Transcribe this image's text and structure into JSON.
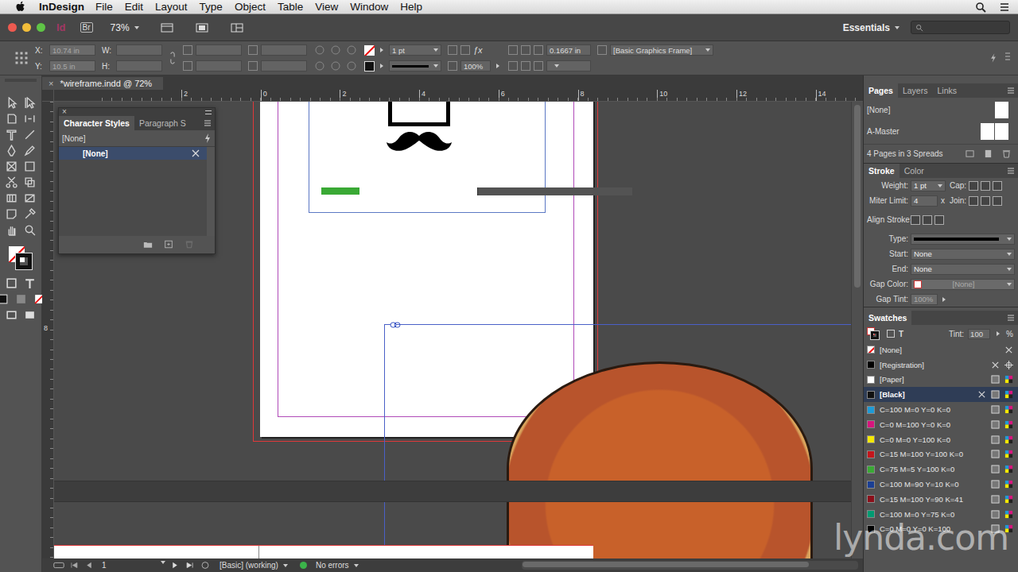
{
  "menubar": {
    "app": "InDesign",
    "items": [
      "File",
      "Edit",
      "Layout",
      "Type",
      "Object",
      "Table",
      "View",
      "Window",
      "Help"
    ]
  },
  "appbar": {
    "logo": "Id",
    "bridge": "Br",
    "zoom": "73%",
    "workspace": "Essentials"
  },
  "control": {
    "x": {
      "label": "X:",
      "value": "10.74 in"
    },
    "y": {
      "label": "Y:",
      "value": "10.5 in"
    },
    "w": {
      "label": "W:"
    },
    "h": {
      "label": "H:"
    },
    "stroke_weight": "1 pt",
    "opacity": "100%",
    "corner": "0.1667 in",
    "object_style": "[Basic Graphics Frame]"
  },
  "document": {
    "tab": "*wireframe.indd @ 72%",
    "close": "×",
    "h_ruler": [
      "2",
      "0",
      "2",
      "4",
      "6",
      "8",
      "10",
      "12",
      "14"
    ],
    "v_ruler": [
      "8"
    ]
  },
  "character_styles": {
    "close": "×",
    "tabs": [
      {
        "label": "Character Styles",
        "selected": true
      },
      {
        "label": "Paragraph S",
        "selected": false
      }
    ],
    "current": "[None]",
    "items": [
      {
        "label": "[None]",
        "selected": true
      }
    ]
  },
  "pages_panel": {
    "tabs": [
      {
        "label": "Pages",
        "selected": true
      },
      {
        "label": "Layers",
        "selected": false
      },
      {
        "label": "Links",
        "selected": false
      }
    ],
    "items": [
      {
        "label": "[None]",
        "pages": 1
      },
      {
        "label": "A-Master",
        "pages": 2
      }
    ],
    "summary": "4 Pages in 3 Spreads"
  },
  "stroke_panel": {
    "tabs": [
      {
        "label": "Stroke",
        "selected": true
      },
      {
        "label": "Color",
        "selected": false
      }
    ],
    "weight": {
      "label": "Weight:",
      "value": "1 pt"
    },
    "cap_label": "Cap:",
    "miter": {
      "label": "Miter Limit:",
      "value": "4",
      "times": "x"
    },
    "join_label": "Join:",
    "align_label": "Align Stroke:",
    "type_label": "Type:",
    "start": {
      "label": "Start:",
      "value": "None"
    },
    "end": {
      "label": "End:",
      "value": "None"
    },
    "gap_color": {
      "label": "Gap Color:",
      "value": "[None]"
    },
    "gap_tint": {
      "label": "Gap Tint:",
      "value": "100%"
    }
  },
  "swatches": {
    "title": "Swatches",
    "text_icon": "T",
    "tint_label": "Tint:",
    "tint": "100",
    "percent": "%",
    "items": [
      {
        "name": "[None]",
        "kind": "none",
        "color": "#ffffff",
        "locked": true,
        "selected": false
      },
      {
        "name": "[Registration]",
        "kind": "registration",
        "color": "#000000",
        "locked": true,
        "selected": false
      },
      {
        "name": "[Paper]",
        "kind": "process",
        "color": "#ffffff",
        "locked": false,
        "selected": false
      },
      {
        "name": "[Black]",
        "kind": "process",
        "color": "#111111",
        "locked": true,
        "selected": true
      },
      {
        "name": "C=100 M=0 Y=0 K=0",
        "kind": "process",
        "color": "#1e9ad6",
        "locked": false,
        "selected": false
      },
      {
        "name": "C=0 M=100 Y=0 K=0",
        "kind": "process",
        "color": "#d6157d",
        "locked": false,
        "selected": false
      },
      {
        "name": "C=0 M=0 Y=100 K=0",
        "kind": "process",
        "color": "#f5e900",
        "locked": false,
        "selected": false
      },
      {
        "name": "C=15 M=100 Y=100 K=0",
        "kind": "process",
        "color": "#c4161c",
        "locked": false,
        "selected": false
      },
      {
        "name": "C=75 M=5 Y=100 K=0",
        "kind": "process",
        "color": "#3aa935",
        "locked": false,
        "selected": false
      },
      {
        "name": "C=100 M=90 Y=10 K=0",
        "kind": "process",
        "color": "#1b3f94",
        "locked": false,
        "selected": false
      },
      {
        "name": "C=15 M=100 Y=90 K=41",
        "kind": "process",
        "color": "#8b0f1a",
        "locked": false,
        "selected": false
      },
      {
        "name": "C=100 M=0 Y=75 K=0",
        "kind": "process",
        "color": "#009b72",
        "locked": false,
        "selected": false
      },
      {
        "name": "C=0 M=0 Y=0 K=100",
        "kind": "process",
        "color": "#000000",
        "locked": false,
        "selected": false
      }
    ]
  },
  "status_bar": {
    "page": "1",
    "profile": "[Basic] (working)",
    "preflight": "No errors",
    "preflight_ok": true
  },
  "watermark": "lynda.com"
}
